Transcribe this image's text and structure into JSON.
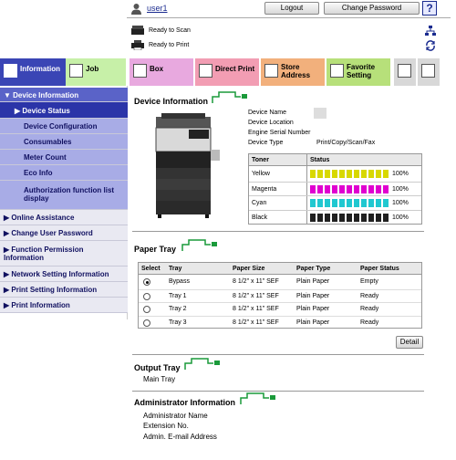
{
  "header": {
    "user_name": "user1",
    "logout_label": "Logout",
    "change_password_label": "Change Password",
    "help_label": "?",
    "status": [
      {
        "label": "Ready to Scan"
      },
      {
        "label": "Ready to Print"
      }
    ]
  },
  "tabs": [
    {
      "label": "Information",
      "color": "#3a45b5"
    },
    {
      "label": "Job",
      "color": "#c7f0a8"
    },
    {
      "label": "Box",
      "color": "#e8a9df"
    },
    {
      "label": "Direct Print",
      "color": "#f29db3"
    },
    {
      "label": "Store Address",
      "color": "#f2b07c"
    },
    {
      "label": "Favorite Setting",
      "color": "#b7e07a"
    }
  ],
  "nav": {
    "device_information": "Device Information",
    "device_status": "Device Status",
    "device_configuration": "Device Configuration",
    "consumables": "Consumables",
    "meter_count": "Meter Count",
    "eco_info": "Eco Info",
    "auth_function_list": "Authorization function list display",
    "online_assistance": "Online Assistance",
    "change_user_password": "Change User Password",
    "function_permission": "Function Permission Information",
    "network_setting": "Network Setting Information",
    "print_setting": "Print Setting Information",
    "print_information": "Print Information"
  },
  "device_info": {
    "title": "Device Information",
    "fields": [
      {
        "label": "Device Name",
        "value": ""
      },
      {
        "label": "Device Location",
        "value": ""
      },
      {
        "label": "Engine Serial Number",
        "value": ""
      },
      {
        "label": "Device Type",
        "value": "Print/Copy/Scan/Fax"
      }
    ],
    "toner_header": "Toner",
    "status_header": "Status",
    "toner": [
      {
        "name": "Yellow",
        "percent": "100%",
        "fill": 1.0,
        "color": "#d8d800"
      },
      {
        "name": "Magenta",
        "percent": "100%",
        "fill": 1.0,
        "color": "#e000d0"
      },
      {
        "name": "Cyan",
        "percent": "100%",
        "fill": 1.0,
        "color": "#20c8d0"
      },
      {
        "name": "Black",
        "percent": "100%",
        "fill": 1.0,
        "color": "#202020"
      }
    ]
  },
  "paper_tray": {
    "title": "Paper Tray",
    "columns": [
      "Select",
      "Tray",
      "Paper Size",
      "Paper Type",
      "Paper Status"
    ],
    "rows": [
      {
        "tray": "Bypass",
        "size": "8 1/2\" x 11\" SEF",
        "type": "Plain Paper",
        "status": "Empty",
        "selected": true
      },
      {
        "tray": "Tray 1",
        "size": "8 1/2\" x 11\" SEF",
        "type": "Plain Paper",
        "status": "Ready",
        "selected": false
      },
      {
        "tray": "Tray 2",
        "size": "8 1/2\" x 11\" SEF",
        "type": "Plain Paper",
        "status": "Ready",
        "selected": false
      },
      {
        "tray": "Tray 3",
        "size": "8 1/2\" x 11\" SEF",
        "type": "Plain Paper",
        "status": "Ready",
        "selected": false
      }
    ],
    "detail_label": "Detail"
  },
  "output_tray": {
    "title": "Output Tray",
    "item": "Main Tray"
  },
  "admin_info": {
    "title": "Administrator Information",
    "fields": [
      "Administrator Name",
      "Extension No.",
      "Admin. E-mail Address"
    ]
  }
}
